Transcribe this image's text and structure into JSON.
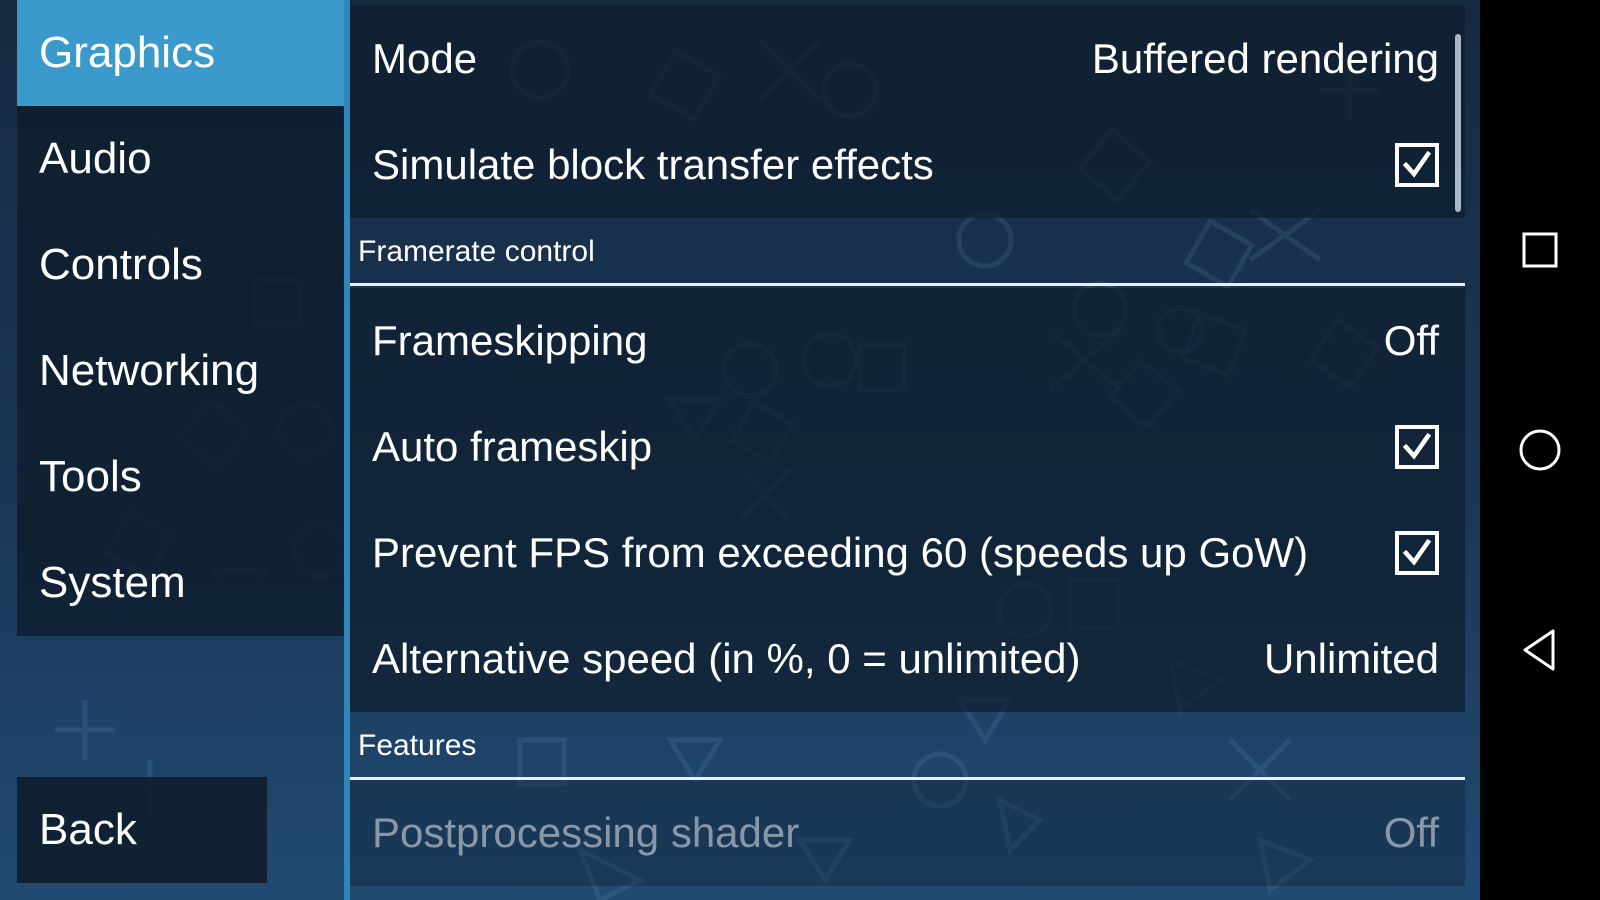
{
  "categories": [
    {
      "label": "Graphics",
      "selected": true
    },
    {
      "label": "Audio",
      "selected": false
    },
    {
      "label": "Controls",
      "selected": false
    },
    {
      "label": "Networking",
      "selected": false
    },
    {
      "label": "Tools",
      "selected": false
    },
    {
      "label": "System",
      "selected": false
    }
  ],
  "back_label": "Back",
  "settings": {
    "mode": {
      "label": "Mode",
      "value": "Buffered rendering"
    },
    "simulate_block": {
      "label": "Simulate block transfer effects",
      "checked": true
    },
    "framerate_header": "Framerate control",
    "frameskipping": {
      "label": "Frameskipping",
      "value": "Off"
    },
    "auto_frameskip": {
      "label": "Auto frameskip",
      "checked": true
    },
    "prevent_fps": {
      "label": "Prevent FPS from exceeding 60 (speeds up GoW)",
      "checked": true
    },
    "alt_speed": {
      "label": "Alternative speed (in %, 0 = unlimited)",
      "value": "Unlimited"
    },
    "features_header": "Features",
    "postprocessing": {
      "label": "Postprocessing shader",
      "value": "Off",
      "disabled": true
    }
  },
  "colors": {
    "accent": "#3a9acb",
    "item_bg": "#0e1d2e",
    "background": "#1b3757",
    "navbar": "#000000"
  },
  "nav_icons": [
    "recents-square-icon",
    "home-circle-icon",
    "back-triangle-icon"
  ]
}
